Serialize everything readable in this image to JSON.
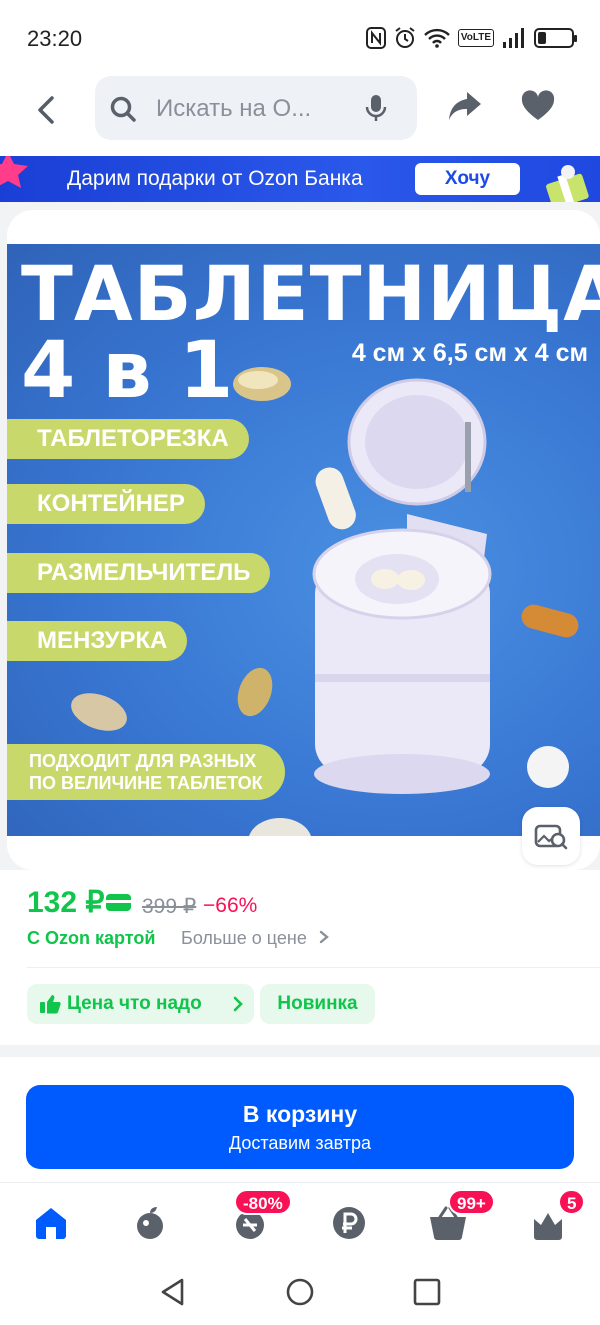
{
  "status_bar": {
    "time": "23:20",
    "volte": "VoLTE",
    "battery_level": 0.25
  },
  "search": {
    "placeholder": "Искать на О..."
  },
  "promo_banner": {
    "text": "Дарим подарки от Ozon Банка",
    "button_label": "Хочу"
  },
  "product_image": {
    "title": "ТАБЛЕТНИЦА",
    "subtitle": "4 в 1",
    "size": "4 см x 6,5 см x 4 см",
    "features": [
      "ТАБЛЕТОРЕЗКА",
      "КОНТЕЙНЕР",
      "РАЗМЕЛЬЧИТЕЛЬ",
      "МЕНЗУРКА"
    ],
    "note_line1": "ПОДХОДИТ ДЛЯ РАЗНЫХ",
    "note_line2": "ПО ВЕЛИЧИНЕ ТАБЛЕТОК"
  },
  "price": {
    "current": "132 ₽",
    "old": "399 ₽",
    "discount": "−66%",
    "card_label": "С Ozon картой",
    "more_link": "Больше о цене"
  },
  "badges": {
    "price_ok": "Цена что надо",
    "new": "Новинка"
  },
  "cart": {
    "title": "В корзину",
    "subtitle": "Доставим завтра"
  },
  "bottom_nav": {
    "items": [
      {
        "icon": "home-icon"
      },
      {
        "icon": "fresh-icon"
      },
      {
        "icon": "sale-icon",
        "badge": "-80%"
      },
      {
        "icon": "ruble-icon"
      },
      {
        "icon": "cart-icon",
        "badge": "99+"
      },
      {
        "icon": "profile-icon",
        "badge": "5"
      }
    ]
  },
  "colors": {
    "accent": "#005bff",
    "green": "#10c44c",
    "pink": "#f91155"
  }
}
